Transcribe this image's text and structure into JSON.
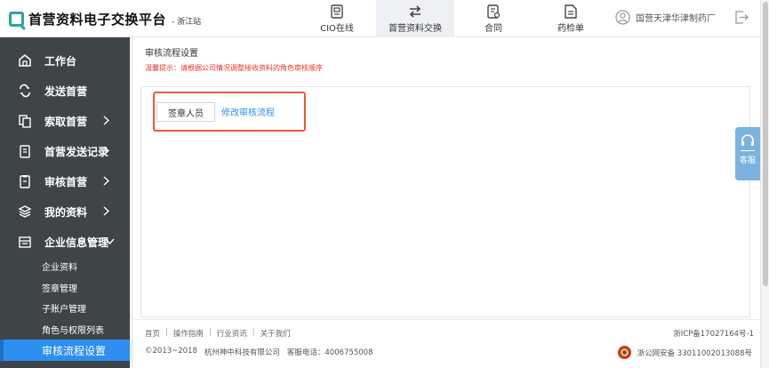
{
  "header": {
    "logo_title": "首营资料电子交换平台",
    "logo_sub": "- 浙江站",
    "nav": [
      {
        "label": "CIO在线",
        "icon": "id-card-icon"
      },
      {
        "label": "首营资料交换",
        "icon": "swap-arrows-icon",
        "active": true
      },
      {
        "label": "合同",
        "icon": "contract-icon"
      },
      {
        "label": "药检单",
        "icon": "document-icon"
      }
    ],
    "user_name": "国营天津华津制药厂"
  },
  "sidebar": {
    "items": [
      {
        "label": "工作台",
        "icon": "home-icon"
      },
      {
        "label": "发送首营",
        "icon": "send-loop-icon"
      },
      {
        "label": "索取首营",
        "icon": "request-doc-icon"
      },
      {
        "label": "首营发送记录",
        "icon": "clipboard-icon"
      },
      {
        "label": "审核首营",
        "icon": "audit-clipboard-icon"
      },
      {
        "label": "我的资料",
        "icon": "layers-icon"
      },
      {
        "label": "企业信息管理",
        "icon": "enterprise-icon"
      }
    ],
    "sub_items": [
      {
        "label": "企业资料"
      },
      {
        "label": "签章管理"
      },
      {
        "label": "子账户管理"
      },
      {
        "label": "角色与权限列表"
      },
      {
        "label": "审核流程设置",
        "active": true
      }
    ]
  },
  "main": {
    "title": "审核流程设置",
    "tip_prefix": "温馨提示：",
    "tip_text": "请根据公司情况调整接收资料的角色审核顺序",
    "signer_label": "签章人员",
    "edit_label": "修改审核流程"
  },
  "footer": {
    "links": [
      "首页",
      "操作指南",
      "行业资讯",
      "关于我们"
    ],
    "copyright": "©2013~2018",
    "company": "杭州神中科技有限公司",
    "hotline": "客服电话：4006755008",
    "icp": "浙ICP备17027164号-1",
    "police": "浙公网安备 33011002013088号"
  },
  "service": {
    "label": "客服"
  },
  "colors": {
    "accent": "#2d8ff0",
    "sidebar_bg": "#3f4447",
    "tip_red": "#e8352a",
    "highlight": "#e85a3c"
  }
}
